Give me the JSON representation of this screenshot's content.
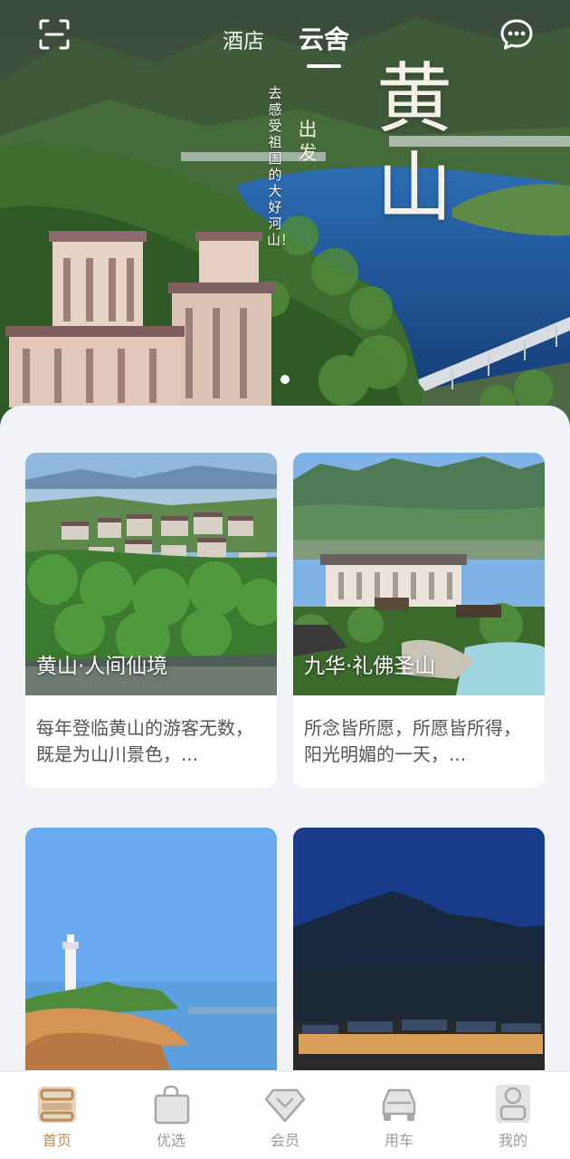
{
  "header": {
    "tabs": [
      {
        "label": "酒店",
        "active": false
      },
      {
        "label": "云舍",
        "active": true
      }
    ]
  },
  "banner": {
    "slogan_vertical": "去感受祖国的大好河山！",
    "sub_vertical": "出发",
    "title_vertical": "黄山",
    "slide_count": 1,
    "active_slide": 1
  },
  "cards": [
    {
      "title": "黄山·人间仙境",
      "description": "每年登临黄山的游客无数，既是为山川景色，..."
    },
    {
      "title": "九华·礼佛圣山",
      "description": "所念皆所愿，所愿皆所得，阳光明媚的一天，..."
    },
    {
      "title": "",
      "description": ""
    },
    {
      "title": "",
      "description": ""
    }
  ],
  "nav": {
    "items": [
      {
        "label": "首页",
        "icon": "home-icon",
        "active": true
      },
      {
        "label": "优选",
        "icon": "shopping-bag-icon",
        "active": false
      },
      {
        "label": "会员",
        "icon": "diamond-icon",
        "active": false
      },
      {
        "label": "用车",
        "icon": "car-icon",
        "active": false
      },
      {
        "label": "我的",
        "icon": "user-icon",
        "active": false
      }
    ]
  },
  "colors": {
    "accent": "#b98c5a",
    "inactive": "#9a9a9a",
    "lake": "#1f5a9e"
  }
}
